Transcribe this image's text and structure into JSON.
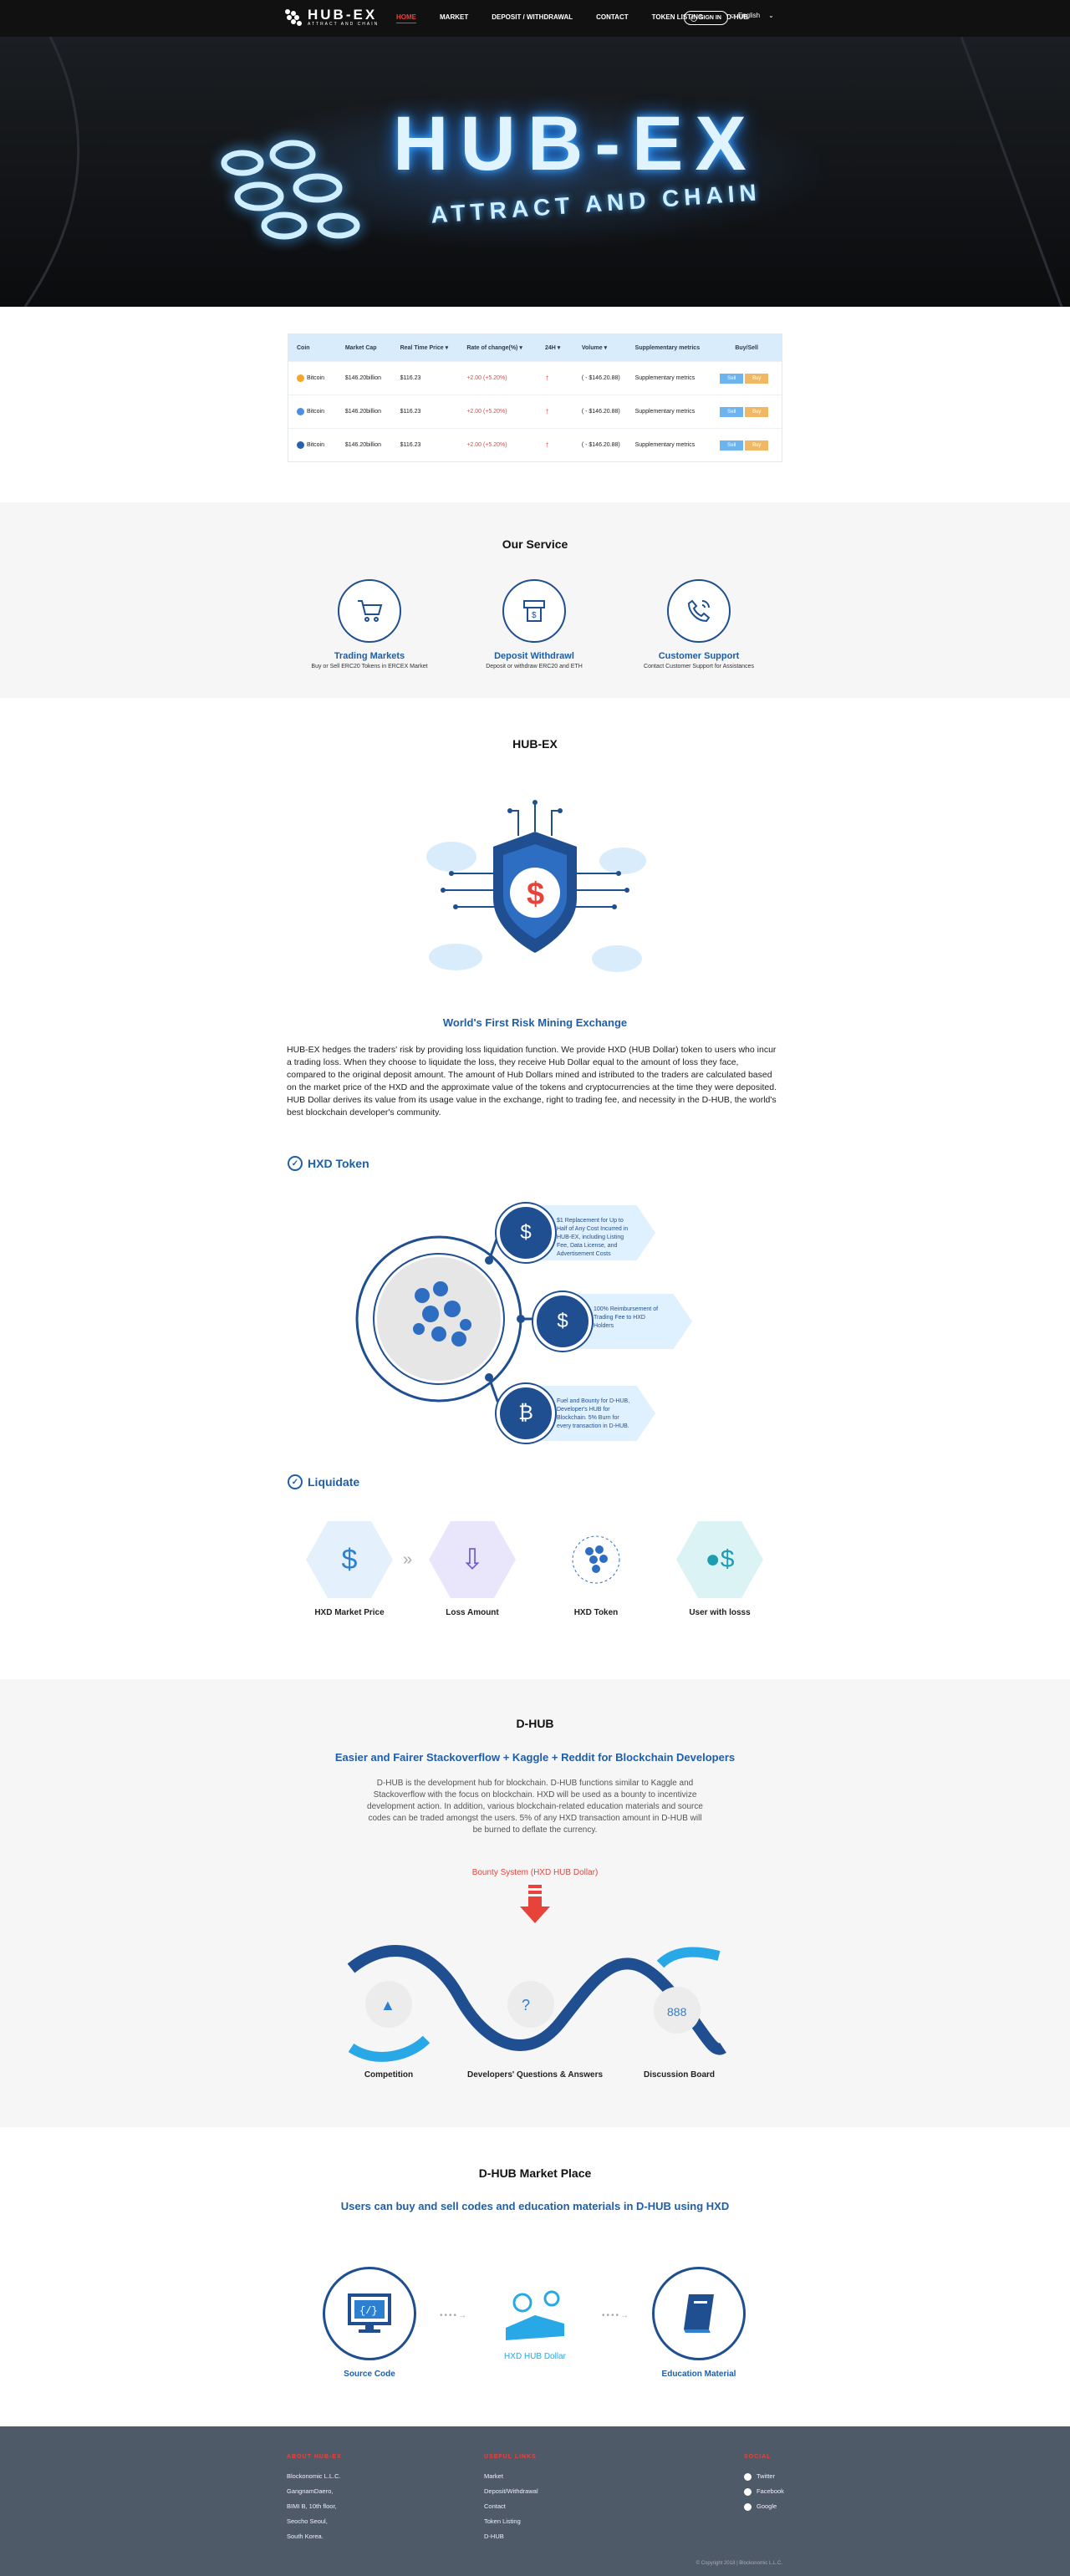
{
  "header": {
    "logo_title": "HUB-EX",
    "logo_sub": "ATTRACT AND CHAIN",
    "nav": [
      "HOME",
      "MARKET",
      "DEPOSIT / WITHDRAWAL",
      "CONTACT",
      "TOKEN LISTING",
      "D-HUB"
    ],
    "signin": "SIGN IN",
    "language": "English"
  },
  "hero": {
    "title": "HUB-EX",
    "subtitle": "ATTRACT AND CHAIN"
  },
  "market_table": {
    "headers": [
      "Coin",
      "Market Cap",
      "Real Time Price",
      "Rate of change(%)",
      "24H",
      "Volume",
      "Supplementary metrics",
      "Buy/Sell"
    ],
    "rows": [
      {
        "coin": "Bitcoin",
        "cap": "$146.20billion",
        "price": "$116.23",
        "change": "+2.00 (+5.20%)",
        "volume": "( - $146.20.88)",
        "metrics": "Supplementary metrics",
        "sell": "Sell",
        "buy": "Buy",
        "color": "#f5a623"
      },
      {
        "coin": "Bitcoin",
        "cap": "$146.20billion",
        "price": "$116.23",
        "change": "+2.00 (+5.20%)",
        "volume": "( - $146.20.88)",
        "metrics": "Supplementary metrics",
        "sell": "Sell",
        "buy": "Buy",
        "color": "#4a90e2"
      },
      {
        "coin": "Bitcoin",
        "cap": "$146.20billion",
        "price": "$116.23",
        "change": "+2.00 (+5.20%)",
        "volume": "( - $146.20.88)",
        "metrics": "Supplementary metrics",
        "sell": "Sell",
        "buy": "Buy",
        "color": "#2563b0"
      }
    ]
  },
  "services": {
    "title": "Our Service",
    "items": [
      {
        "name": "Trading Markets",
        "desc": "Buy or Sell ERC20 Tokens in ERCEX Market",
        "icon": "cart-icon"
      },
      {
        "name": "Deposit Withdrawl",
        "desc": "Deposit or withdraw ERC20 and ETH",
        "icon": "atm-icon"
      },
      {
        "name": "Customer Support",
        "desc": "Contact Customer Support for Assistances",
        "icon": "phone-icon"
      }
    ]
  },
  "hubex": {
    "title": "HUB-EX",
    "subtitle": "World's First Risk Mining Exchange",
    "paragraph": "HUB-EX hedges the traders' risk by providing loss liquidation function. We provide HXD (HUB Dollar) token to users who incur a trading loss. When they choose to liquidate the loss, they receive Hub Dollar equal to the amount of loss they face, compared to the original deposit amount. The amount of Hub Dollars mined and istributed to the traders are calculated based on the market price of the HXD and the approximate value of the tokens and cryptocurrencies at the time they were deposited. HUB Dollar derives its value from its usage value in the exchange, right to trading fee, and necessity in the D-HUB, the world's best blockchain developer's community."
  },
  "hxd": {
    "title": "HXD Token",
    "tags": [
      "$1 Replacement for Up to Half of Any Cost Incurred in HUB-EX, including Listing Fee, Data License, and Advertisement Costs",
      "100% Reimbursement of Trading Fee to HXD Holders",
      "Fuel and Bounty for D-HUB, Developer's HUB for Blockchain. 5% Burn for every transaction in D-HUB."
    ]
  },
  "liquidate": {
    "title": "Liquidate",
    "items": [
      "HXD Market Price",
      "Loss Amount",
      "HXD Token",
      "User with losss"
    ]
  },
  "dhub": {
    "title": "D-HUB",
    "subtitle": "Easier and Fairer Stackoverflow + Kaggle + Reddit for Blockchain Developers",
    "paragraph": "D-HUB is the development hub for blockchain. D-HUB functions similar to Kaggle and Stackoverflow with the focus on blockchain. HXD will be used as a bounty to incentivize development action. In addition, various blockchain-related education materials and source codes can be traded amongst the users. 5% of any HXD transaction amount in D-HUB will be burned to deflate the currency.",
    "bounty": "Bounty System (HXD HUB Dollar)",
    "steps": [
      "Competition",
      "Developers' Questions & Answers",
      "Discussion Board"
    ]
  },
  "marketplace": {
    "title": "D-HUB Market Place",
    "subtitle": "Users can buy and sell codes and education materials in D-HUB using HXD",
    "items": [
      "Source Code",
      "HXD HUB Dollar",
      "Education Material"
    ]
  },
  "footer": {
    "about_head": "ABOUT HUB-EX",
    "about_lines": [
      "Blockonomic L.L.C.",
      "GangnamDaero,",
      "BIMI B, 10th floor,",
      "Seocho Seoul,",
      "South Korea."
    ],
    "links_head": "USEFUL LINKS",
    "links": [
      "Market",
      "Deposit/Withdrawal",
      "Contact",
      "Token Listing",
      "D-HUB"
    ],
    "social_head": "SOCIAL",
    "social": [
      "Twitter",
      "Facebook",
      "Google"
    ],
    "copyright": "© Copyright 2018 | Blockonomic L.L.C."
  }
}
